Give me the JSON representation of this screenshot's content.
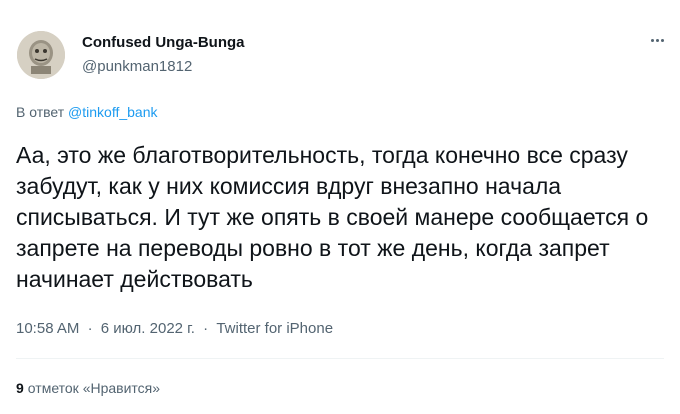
{
  "author": {
    "display_name": "Confused Unga-Bunga",
    "handle": "@punkman1812"
  },
  "reply": {
    "prefix": "В ответ",
    "mention": "@tinkoff_bank"
  },
  "tweet": {
    "text": "Аа, это же благотворительность, тогда конечно все сразу забудут, как у них комиссия вдруг внезапно начала списываться. И тут же опять в своей манере сообщается о запрете на переводы ровно в тот же день, когда запрет начинает действовать"
  },
  "meta": {
    "time": "10:58 AM",
    "separator": "·",
    "date": "6 июл. 2022 г.",
    "source": "Twitter for iPhone"
  },
  "stats": {
    "likes_count": "9",
    "likes_label": "отметок «Нравится»"
  },
  "icons": {
    "more": "more-horizontal-icon",
    "avatar": "avatar-image"
  },
  "colors": {
    "link": "#1d9bf0",
    "secondary_text": "#536471",
    "primary_text": "#0f1419"
  }
}
